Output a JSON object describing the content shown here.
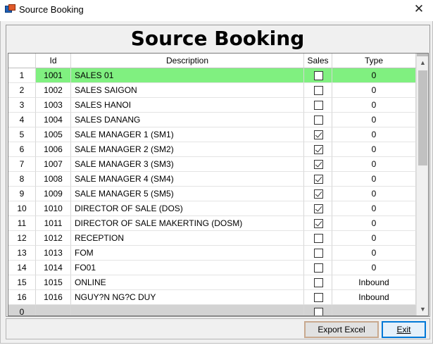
{
  "window": {
    "title": "Source Booking",
    "close_glyph": "✕",
    "icon": "app-window-icon"
  },
  "heading": "Source Booking",
  "columns": {
    "rownum": "",
    "id": "Id",
    "description": "Description",
    "sales": "Sales",
    "type": "Type"
  },
  "rows": [
    {
      "n": "1",
      "id": "1001",
      "description": "SALES 01",
      "sales": false,
      "type": "0",
      "selected": true
    },
    {
      "n": "2",
      "id": "1002",
      "description": "SALES SAIGON",
      "sales": false,
      "type": "0"
    },
    {
      "n": "3",
      "id": "1003",
      "description": "SALES HANOI",
      "sales": false,
      "type": "0"
    },
    {
      "n": "4",
      "id": "1004",
      "description": "SALES DANANG",
      "sales": false,
      "type": "0"
    },
    {
      "n": "5",
      "id": "1005",
      "description": "SALE MANAGER 1 (SM1)",
      "sales": true,
      "type": "0"
    },
    {
      "n": "6",
      "id": "1006",
      "description": "SALE MANAGER 2 (SM2)",
      "sales": true,
      "type": "0"
    },
    {
      "n": "7",
      "id": "1007",
      "description": "SALE MANAGER 3 (SM3)",
      "sales": true,
      "type": "0"
    },
    {
      "n": "8",
      "id": "1008",
      "description": "SALE MANAGER 4 (SM4)",
      "sales": true,
      "type": "0"
    },
    {
      "n": "9",
      "id": "1009",
      "description": "SALE MANAGER 5 (SM5)",
      "sales": true,
      "type": "0"
    },
    {
      "n": "10",
      "id": "1010",
      "description": "DIRECTOR OF SALE (DOS)",
      "sales": true,
      "type": "0"
    },
    {
      "n": "11",
      "id": "1011",
      "description": "DIRECTOR OF SALE MAKERTING (DOSM)",
      "sales": true,
      "type": "0"
    },
    {
      "n": "12",
      "id": "1012",
      "description": "RECEPTION",
      "sales": false,
      "type": "0"
    },
    {
      "n": "13",
      "id": "1013",
      "description": "FOM",
      "sales": false,
      "type": "0"
    },
    {
      "n": "14",
      "id": "1014",
      "description": "FO01",
      "sales": false,
      "type": "0"
    },
    {
      "n": "15",
      "id": "1015",
      "description": "ONLINE",
      "sales": false,
      "type": "Inbound"
    },
    {
      "n": "16",
      "id": "1016",
      "description": "NGUY?N NG?C DUY",
      "sales": false,
      "type": "Inbound"
    },
    {
      "n": "0",
      "id": "",
      "description": "",
      "sales": false,
      "type": "",
      "new_row": true
    }
  ],
  "buttons": {
    "export": "Export Excel",
    "exit": "Exit"
  },
  "scrollbar": {
    "up": "▲",
    "down": "▼"
  },
  "colors": {
    "selected_row": "#80f080",
    "grid_background": "#ababab",
    "exit_border": "#0078d7"
  }
}
